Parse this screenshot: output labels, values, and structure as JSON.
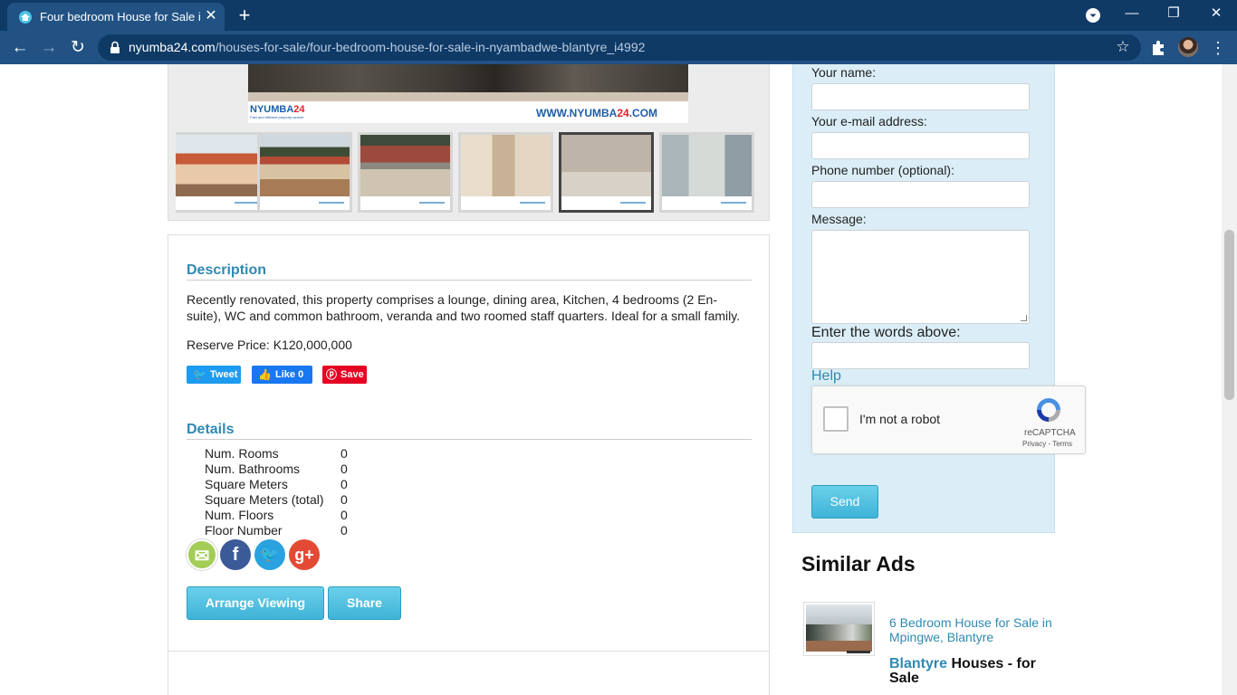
{
  "browser": {
    "tab_title": "Four bedroom House for Sale in Nyambadwe",
    "tab_close": "✕",
    "new_tab": "+",
    "url_host": "nyumba24.com",
    "url_path": "/houses-for-sale/four-bedroom-house-for-sale-in-nyambadwe-blantyre_i4992",
    "window_controls": {
      "minimize": "—",
      "restore": "❐",
      "close": "✕"
    },
    "nav": {
      "back": "←",
      "forward": "→",
      "reload": "↻",
      "bookmark": "☆",
      "menu": "⋮"
    }
  },
  "gallery": {
    "logo": "NYUMBA",
    "logo_num": "24",
    "logo_tagline": "Fast and efficient property search",
    "banner_url_prefix": "WWW.NYUMBA",
    "banner_url_num": "24",
    "banner_url_suffix": ".COM",
    "thumbnails": [
      {
        "name": "house-exterior-front"
      },
      {
        "name": "house-exterior-side"
      },
      {
        "name": "yard-wall"
      },
      {
        "name": "kitchen"
      },
      {
        "name": "living-room",
        "active": true
      },
      {
        "name": "corridor"
      }
    ]
  },
  "listing": {
    "description_heading": "Description",
    "description": "Recently renovated, this property comprises a lounge, dining area, Kitchen, 4 bedrooms (2 En-suite), WC and common bathroom, veranda and two roomed staff quarters. Ideal for a small family.",
    "reserve_price": "Reserve Price: K120,000,000",
    "social": {
      "tweet": "Tweet",
      "like": "Like 0",
      "save": "Save"
    },
    "details_heading": "Details",
    "details": [
      {
        "label": "Num. Rooms",
        "value": "0"
      },
      {
        "label": "Num. Bathrooms",
        "value": "0"
      },
      {
        "label": "Square Meters",
        "value": "0"
      },
      {
        "label": "Square Meters (total)",
        "value": "0"
      },
      {
        "label": "Num. Floors",
        "value": "0"
      },
      {
        "label": "Floor Number",
        "value": "0"
      }
    ],
    "share_icons": {
      "email": "✉",
      "facebook": "f",
      "twitter": "🐦",
      "google_plus": "g+"
    },
    "arrange_viewing": "Arrange Viewing",
    "share": "Share"
  },
  "contact_form": {
    "name_label": "Your name:",
    "email_label": "Your e-mail address:",
    "phone_label": "Phone number (optional):",
    "message_label": "Message:",
    "captcha_label": "Enter the words above:",
    "help": "Help",
    "recaptcha_label": "I'm not a robot",
    "recaptcha_brand": "reCAPTCHA",
    "recaptcha_terms": "Privacy - Terms",
    "send": "Send"
  },
  "similar": {
    "heading": "Similar Ads",
    "items": [
      {
        "title": "6 Bedroom House for Sale in Mpingwe, Blantyre",
        "city": "Blantyre",
        "category": "Houses - for Sale"
      }
    ]
  },
  "colors": {
    "accent": "#2f8ab3",
    "chrome": "#0f3a66",
    "toolbar": "#215283",
    "form_bg": "#dbeef7"
  }
}
